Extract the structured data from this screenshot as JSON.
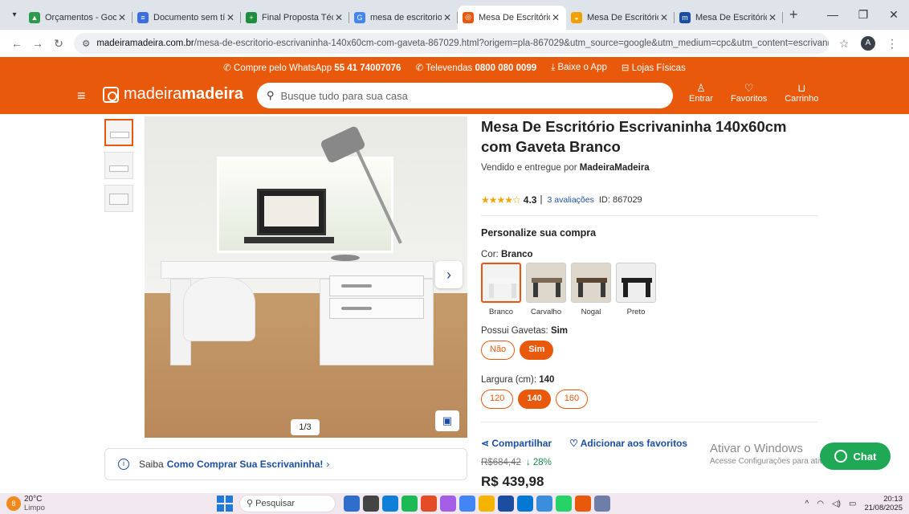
{
  "browser": {
    "tabs": [
      {
        "title": "Orçamentos - Google",
        "color": "#2b9a4a",
        "glyph": "▲",
        "active": false
      },
      {
        "title": "Documento sem título",
        "color": "#3b6fe0",
        "glyph": "≡",
        "active": false
      },
      {
        "title": "Final Proposta Técnica",
        "color": "#1e8e3e",
        "glyph": "+",
        "active": false
      },
      {
        "title": "mesa de escritorio e",
        "color": "#4285f4",
        "glyph": "G",
        "active": false
      },
      {
        "title": "Mesa De Escritório E",
        "color": "#e8590c",
        "glyph": "◎",
        "active": true
      },
      {
        "title": "Mesa De Escritório E",
        "color": "#f0a000",
        "glyph": "◒",
        "active": false
      },
      {
        "title": "Mesa De Escritório E",
        "color": "#1b4ea0",
        "glyph": "m",
        "active": false
      }
    ],
    "new_tab": "+",
    "url_site": "madeiramadeira.com.br",
    "url_rest": "/mesa-de-escritorio-escrivaninha-140x60cm-com-gaveta-867029.html?origem=pla-867029&utm_source=google&utm_medium=cpc&utm_content=escrivaninhas-para-escritori...",
    "profile_initial": "A"
  },
  "topstrip": {
    "whatsapp_label": "Compre pelo WhatsApp",
    "whatsapp_number": "55 41 74007076",
    "televendas_label": "Televendas",
    "televendas_number": "0800 080 0099",
    "app_label": "Baixe o App",
    "stores_label": "Lojas Físicas"
  },
  "header": {
    "logo_light": "madeira",
    "logo_bold": "madeira",
    "search_placeholder": "Busque tudo para sua casa",
    "enter": "Entrar",
    "favorites": "Favoritos",
    "cart": "Carrinho"
  },
  "gallery": {
    "counter": "1/3"
  },
  "info": {
    "prefix": "Saiba",
    "link": "Como Comprar Sua Escrivaninha!"
  },
  "product": {
    "title": "Mesa De Escritório Escrivaninha 140x60cm com Gaveta Branco",
    "seller_prefix": "Vendido e entregue por",
    "seller": "MadeiraMadeira",
    "stars": "★★★★☆",
    "rating": "4.3",
    "reviews": "3 avaliações",
    "id": "ID: 867029",
    "personalize": "Personalize sua compra",
    "color_label": "Cor:",
    "color_value": "Branco",
    "colors": [
      {
        "name": "Branco",
        "top": "#f6f6f6",
        "leg": "#e0e0e0",
        "bg": "#f3f3f3",
        "selected": true
      },
      {
        "name": "Carvalho",
        "top": "#7a6a52",
        "leg": "#3a3a3a",
        "bg": "#ddd7cc",
        "selected": false
      },
      {
        "name": "Nogal",
        "top": "#5a4630",
        "leg": "#3a3a3a",
        "bg": "#ddd7cc",
        "selected": false
      },
      {
        "name": "Preto",
        "top": "#1f1f1f",
        "leg": "#1f1f1f",
        "bg": "#eeeeee",
        "selected": false
      }
    ],
    "drawers_label": "Possui Gavetas:",
    "drawers_value": "Sim",
    "drawers_options": [
      "Não",
      "Sim"
    ],
    "width_label": "Largura (cm):",
    "width_value": "140",
    "width_options": [
      "120",
      "140",
      "160"
    ],
    "share": "Compartilhar",
    "favorite": "Adicionar aos favoritos",
    "old_price": "R$684,42",
    "discount": "↓ 28%",
    "price": "R$ 439,98"
  },
  "overlay": {
    "activate_title": "Ativar o Windows",
    "activate_sub": "Acesse Configurações para ativar o Windows.",
    "chat": "Chat"
  },
  "taskbar": {
    "weather_temp": "20°C",
    "weather_desc": "Limpo",
    "weather_badge": "8",
    "search": "Pesquisar",
    "time": "20:13",
    "date": "21/08/2025",
    "apps": [
      "#2f6fcb",
      "#444444",
      "#0f7fd8",
      "#1db954",
      "#e34c26",
      "#a45ee5",
      "#4285f4",
      "#f5b400",
      "#1b4ea0",
      "#0078d4",
      "#3a8edb",
      "#25d366",
      "#e8590c",
      "#6d7fa8"
    ]
  }
}
